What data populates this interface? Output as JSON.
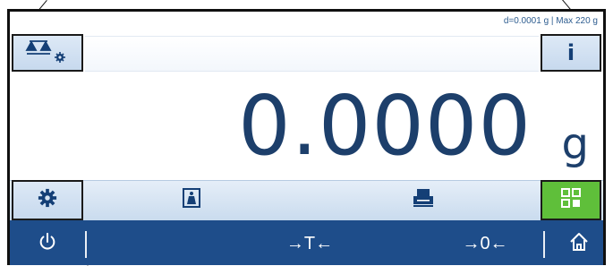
{
  "status": {
    "readability_text": "d=0.0001 g | Max 220 g"
  },
  "weight": {
    "value": "0.0000",
    "unit": "g"
  },
  "top_buttons": {
    "balance_icon": "balance-settings-icon",
    "info_label": "i"
  },
  "app_bar": {
    "settings_icon": "gear-icon",
    "weighing_icon": "weight-icon",
    "printer_icon": "printer-icon",
    "apps_icon": "grid-icon"
  },
  "nav": {
    "power_icon": "power-icon",
    "tare_label": "→T←",
    "zero_label": "→0←",
    "home_icon": "home-icon"
  },
  "colors": {
    "nav_bar": "#1e4d8a",
    "value_text": "#1d3f6b",
    "apps_button": "#5fbf3a"
  }
}
